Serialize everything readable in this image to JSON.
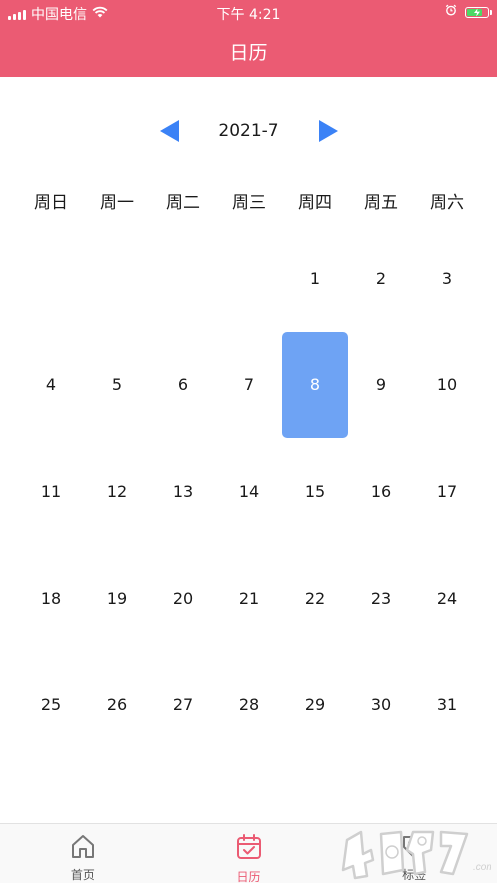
{
  "status_bar": {
    "carrier": "中国电信",
    "time": "下午 4:21"
  },
  "nav": {
    "title": "日历"
  },
  "calendar": {
    "month_label": "2021-7",
    "weekdays": [
      "周日",
      "周一",
      "周二",
      "周三",
      "周四",
      "周五",
      "周六"
    ],
    "leading_blanks": 4,
    "days": [
      "1",
      "2",
      "3",
      "4",
      "5",
      "6",
      "7",
      "8",
      "9",
      "10",
      "11",
      "12",
      "13",
      "14",
      "15",
      "16",
      "17",
      "18",
      "19",
      "20",
      "21",
      "22",
      "23",
      "24",
      "25",
      "26",
      "27",
      "28",
      "29",
      "30",
      "31"
    ],
    "selected_day": "8"
  },
  "tabbar": {
    "tabs": [
      {
        "label": "首页",
        "icon": "home-icon",
        "active": false
      },
      {
        "label": "日历",
        "icon": "calendar-check-icon",
        "active": true
      },
      {
        "label": "标签",
        "icon": "tag-icon",
        "active": false
      }
    ]
  },
  "watermark": {
    "text": "4O9O7.com"
  },
  "colors": {
    "header_bg": "#eb5b73",
    "accent_blue": "#3b82f6",
    "selected_bg": "#6ea3f4",
    "tab_active": "#eb5b73"
  }
}
